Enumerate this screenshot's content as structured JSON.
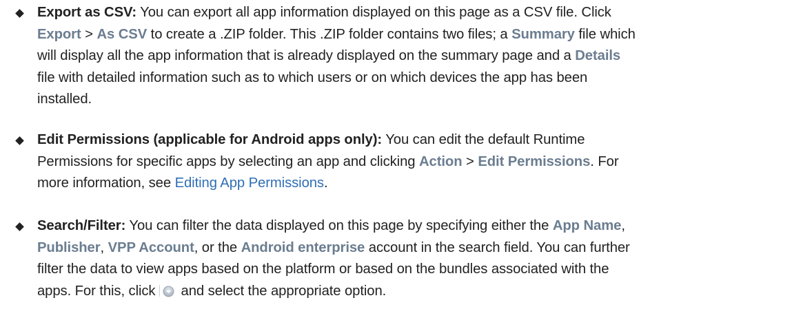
{
  "items": [
    {
      "lines": [
        [
          {
            "t": "Export as CSV:",
            "s": "b"
          },
          {
            "t": " You can export all app information displayed on this page as a CSV file. Click",
            "s": ""
          }
        ],
        [
          {
            "t": "Export",
            "s": "ui"
          },
          {
            "t": " > ",
            "s": ""
          },
          {
            "t": "As CSV",
            "s": "ui"
          },
          {
            "t": " to create a .ZIP folder. This .ZIP folder contains two files; a ",
            "s": ""
          },
          {
            "t": "Summary",
            "s": "ui"
          },
          {
            "t": " file which",
            "s": ""
          }
        ],
        [
          {
            "t": "will display all the app information that is already displayed on the summary page and a ",
            "s": ""
          },
          {
            "t": "Details",
            "s": "ui"
          }
        ],
        [
          {
            "t": "file with detailed information such as to which users or on which devices the app has been",
            "s": ""
          }
        ],
        [
          {
            "t": "installed.",
            "s": ""
          }
        ]
      ]
    },
    {
      "lines": [
        [
          {
            "t": "Edit Permissions (applicable for Android apps only):",
            "s": "b"
          },
          {
            "t": " You can edit the default Runtime",
            "s": ""
          }
        ],
        [
          {
            "t": "Permissions for specific apps by selecting an app and clicking ",
            "s": ""
          },
          {
            "t": "Action",
            "s": "ui"
          },
          {
            "t": " > ",
            "s": ""
          },
          {
            "t": "Edit Permissions",
            "s": "ui"
          },
          {
            "t": ". For",
            "s": ""
          }
        ],
        [
          {
            "t": "more information, see ",
            "s": ""
          },
          {
            "t": "Editing App Permissions",
            "s": "lnk"
          },
          {
            "t": ".",
            "s": ""
          }
        ]
      ]
    },
    {
      "lines": [
        [
          {
            "t": "Search/Filter:",
            "s": "b"
          },
          {
            "t": " You can filter the data displayed on this page by specifying either the ",
            "s": ""
          },
          {
            "t": "App Name",
            "s": "ui"
          },
          {
            "t": ",",
            "s": ""
          }
        ],
        [
          {
            "t": "Publisher",
            "s": "ui"
          },
          {
            "t": ", ",
            "s": ""
          },
          {
            "t": "VPP Account",
            "s": "ui"
          },
          {
            "t": ", or the ",
            "s": ""
          },
          {
            "t": "Android enterprise",
            "s": "ui"
          },
          {
            "t": " account in the search field. You can further",
            "s": ""
          }
        ],
        [
          {
            "t": "filter the data to view apps based on the platform or based on the bundles associated with the",
            "s": ""
          }
        ],
        [
          {
            "t": "apps. For this, click ",
            "s": ""
          },
          {
            "t": "",
            "s": "icon",
            "icon": "filter-icon"
          },
          {
            "t": " and select the appropriate option.",
            "s": ""
          }
        ]
      ]
    }
  ]
}
